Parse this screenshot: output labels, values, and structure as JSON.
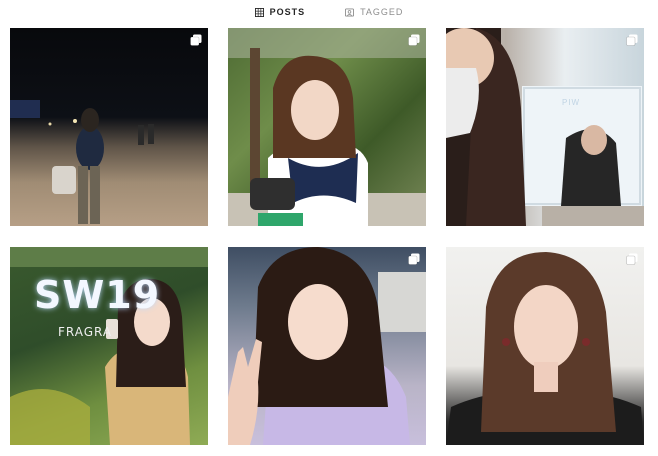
{
  "tabs": [
    {
      "label": "POSTS",
      "icon": "grid-icon",
      "active": true
    },
    {
      "label": "TAGGED",
      "icon": "tag-icon",
      "active": false
    }
  ],
  "posts": [
    {
      "scene": "night-beach",
      "multi": true
    },
    {
      "scene": "forest-selfie",
      "multi": true
    },
    {
      "scene": "store-mirror",
      "multi": true,
      "screen_text": "PIW"
    },
    {
      "scene": "fragrance-sign",
      "multi": false,
      "sign_text": "SW19",
      "sub_text": "FRAGRA"
    },
    {
      "scene": "selfie-v-sign",
      "multi": true
    },
    {
      "scene": "portrait-white-wall",
      "multi": true
    }
  ],
  "colors": {
    "active_tab": "#262626",
    "inactive_tab": "#8e8e8e",
    "background": "#ffffff"
  }
}
